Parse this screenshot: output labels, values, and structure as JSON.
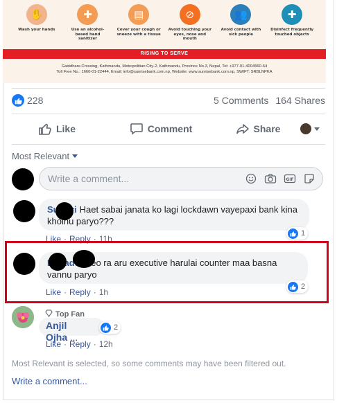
{
  "banner": {
    "tips": [
      {
        "label": "Wash your hands",
        "icon": "hand-wash-icon",
        "color": "#f2b48a"
      },
      {
        "label": "Use an alcohol-based hand sanitizer",
        "icon": "sanitizer-icon",
        "color": "#f39c55"
      },
      {
        "label": "Cover your cough or sneeze with a tissue",
        "icon": "tissue-icon",
        "color": "#f39c55"
      },
      {
        "label": "Avoid touching your eyes, nose and mouth",
        "icon": "no-touch-icon",
        "color": "#f36f21"
      },
      {
        "label": "Avoid contact with sick people",
        "icon": "people-icon",
        "color": "#2c7fb8"
      },
      {
        "label": "Disinfect frequently touched objects",
        "icon": "spray-icon",
        "color": "#1f8fb8"
      }
    ],
    "slogan": "RISING TO SERVE",
    "address_line1": "Gairidhara Crossing, Kathmandu, Metropolitian City-2, Kathmandu, Province No.3, Nepal, Tel: +977-01-4004560-64",
    "address_line2": "Toll Free No.: 1660-01-22444, Email: info@sunrisebank.com.np, Website: www.sunrisebank.com.np, SWIFT: SRBLNPKA"
  },
  "reactions": {
    "like_count": "228",
    "comments": "5 Comments",
    "shares": "164 Shares"
  },
  "actions": {
    "like": "Like",
    "comment": "Comment",
    "share": "Share"
  },
  "sort": {
    "label": "Most Relevant"
  },
  "composer": {
    "placeholder": "Write a comment..."
  },
  "comments": [
    {
      "name": "Su      Giri",
      "text": "Haet sabai janata ko lagi lockdawn vayepaxi bank kina kholnu paryo???",
      "likes": "1",
      "like_label": "Like",
      "reply_label": "Reply",
      "time": "11h"
    },
    {
      "name": "        Bahadur",
      "text": "ceo ra aru executive harulai counter maa basna vannu paryo",
      "likes": "2",
      "like_label": "Like",
      "reply_label": "Reply",
      "time": "1h"
    },
    {
      "badge": "Top Fan",
      "name": "Anjil Ojha",
      "text": "...",
      "likes": "2",
      "like_label": "Like",
      "reply_label": "Reply",
      "time": "12h"
    }
  ],
  "footer": {
    "note": "Most Relevant is selected, so some comments may have been filtered out.",
    "write": "Write a comment..."
  },
  "colors": {
    "accent": "#1877f2",
    "link": "#385898",
    "highlight": "#d0021b",
    "banner_red": "#e31e24"
  }
}
